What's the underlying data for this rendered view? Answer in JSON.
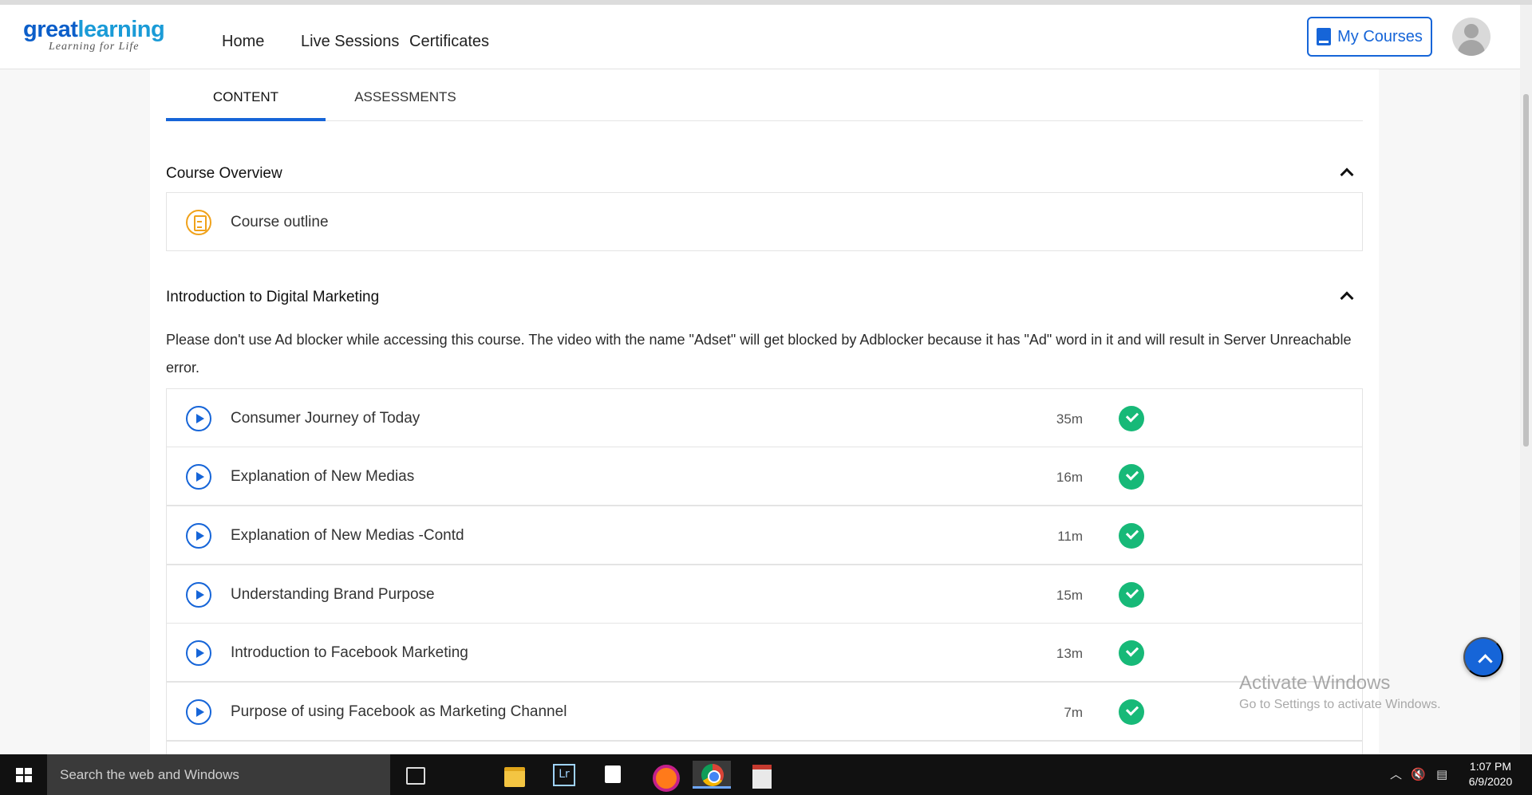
{
  "header": {
    "logo": {
      "brand_great": "great",
      "brand_learning": "learning",
      "tagline": "Learning for Life"
    },
    "nav": {
      "home": "Home",
      "live_sessions": "Live Sessions",
      "certificates": "Certificates"
    },
    "my_courses_label": "My Courses",
    "accent_color": "#1665d8"
  },
  "tabs": {
    "content": "CONTENT",
    "assessments": "ASSESSMENTS",
    "active": "CONTENT"
  },
  "course_overview": {
    "title": "Course Overview",
    "items": [
      {
        "title": "Course outline",
        "icon": "document-icon"
      }
    ]
  },
  "intro_section": {
    "title": "Introduction to Digital Marketing",
    "notice": "Please don't use Ad blocker while accessing this course. The video with the name \"Adset\" will get blocked by Adblocker because it has \"Ad\" word in it and will result in Server Unreachable error.",
    "items": [
      {
        "title": "Consumer Journey of Today",
        "duration": "35m",
        "completed": true
      },
      {
        "title": "Explanation of New Medias",
        "duration": "16m",
        "completed": true
      },
      {
        "title": "Explanation of New Medias -Contd",
        "duration": "11m",
        "completed": true
      },
      {
        "title": "Understanding Brand Purpose",
        "duration": "15m",
        "completed": true
      },
      {
        "title": "Introduction to Facebook Marketing",
        "duration": "13m",
        "completed": true
      },
      {
        "title": "Purpose of using Facebook as Marketing Channel",
        "duration": "7m",
        "completed": true
      }
    ]
  },
  "watermark": {
    "line1": "Activate Windows",
    "line2": "Go to Settings to activate Windows."
  },
  "taskbar": {
    "search_placeholder": "Search the web and Windows",
    "time": "1:07 PM",
    "date": "6/9/2020"
  }
}
